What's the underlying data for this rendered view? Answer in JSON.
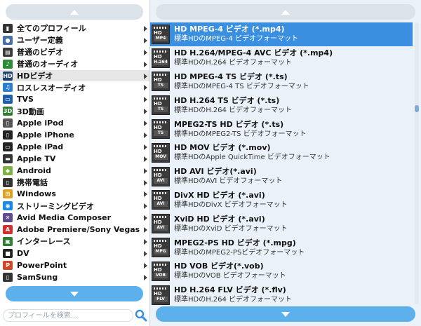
{
  "categories": [
    {
      "label": "全てのプロフィール",
      "icon": "all-profiles-icon",
      "color": "#333333",
      "glyph": "▮"
    },
    {
      "label": "ユーザー定義",
      "icon": "user-icon",
      "color": "#4a6fa5",
      "glyph": "●"
    },
    {
      "label": "普通のビデオ",
      "icon": "video-icon",
      "color": "#3a3a3a",
      "glyph": "▤"
    },
    {
      "label": "普通のオーディオ",
      "icon": "music-icon",
      "color": "#2e8b3a",
      "glyph": "♪"
    },
    {
      "label": "HDビデオ",
      "icon": "hd-video-icon",
      "color": "#1f3f6f",
      "glyph": "HD",
      "selected": true
    },
    {
      "label": "ロスレスオーディオ",
      "icon": "lossless-audio-icon",
      "color": "#2a7fd0",
      "glyph": "♫"
    },
    {
      "label": "TVS",
      "icon": "tv-icon",
      "color": "#1e5fa8",
      "glyph": "▭"
    },
    {
      "label": "3D動画",
      "icon": "3d-video-icon",
      "color": "#2e7d32",
      "glyph": "3D"
    },
    {
      "label": "Apple iPod",
      "icon": "ipod-icon",
      "color": "#555555",
      "glyph": "▯"
    },
    {
      "label": "Apple iPhone",
      "icon": "iphone-icon",
      "color": "#222222",
      "glyph": "▯"
    },
    {
      "label": "Apple iPad",
      "icon": "ipad-icon",
      "color": "#222222",
      "glyph": "▭"
    },
    {
      "label": "Apple TV",
      "icon": "apple-tv-icon",
      "color": "#333333",
      "glyph": "▬"
    },
    {
      "label": "Android",
      "icon": "android-icon",
      "color": "#7cb342",
      "glyph": "◆"
    },
    {
      "label": "携帯電話",
      "icon": "mobile-phone-icon",
      "color": "#333333",
      "glyph": "▯"
    },
    {
      "label": "Windows",
      "icon": "windows-icon",
      "color": "#e0a020",
      "glyph": "⊞"
    },
    {
      "label": "ストリーミングビデオ",
      "icon": "streaming-icon",
      "color": "#1e88e5",
      "glyph": "◉"
    },
    {
      "label": "Avid Media Composer",
      "icon": "avid-icon",
      "color": "#5e4b8b",
      "glyph": "✕"
    },
    {
      "label": "Adobe Premiere/Sony Vegas",
      "icon": "adobe-icon",
      "color": "#d32f2f",
      "glyph": "A"
    },
    {
      "label": "インターレース",
      "icon": "interlace-icon",
      "color": "#2e7d32",
      "glyph": "▣"
    },
    {
      "label": "DV",
      "icon": "dv-camera-icon",
      "color": "#222222",
      "glyph": "■"
    },
    {
      "label": "PowerPoint",
      "icon": "powerpoint-icon",
      "color": "#d24726",
      "glyph": "P"
    },
    {
      "label": "SamSung",
      "icon": "samsung-icon",
      "color": "#333333",
      "glyph": "▯"
    }
  ],
  "formats": [
    {
      "title": "HD MPEG-4 ビデオ (*.mp4)",
      "desc": "標準HDのMPEG-4 ビデオフォーマット",
      "tag": "MP4",
      "selected": true
    },
    {
      "title": "HD H.264/MPEG-4 AVC ビデオ (*.mp4)",
      "desc": "標準HDのH.264 ビデオフォーマット",
      "tag": "H.264"
    },
    {
      "title": "HD MPEG-4 TS ビデオ (*.ts)",
      "desc": "標準HDのMPEG-4 TS ビデオフォーマット",
      "tag": "TS"
    },
    {
      "title": "HD H.264 TS ビデオ (*.ts)",
      "desc": "標準HDのH.264 ビデオフォーマット",
      "tag": "TS"
    },
    {
      "title": "MPEG2-TS HD ビデオ (*.ts)",
      "desc": "標準HDのMPEG2-TS ビデオフォーマット",
      "tag": "TS"
    },
    {
      "title": "HD MOV ビデオ (*.mov)",
      "desc": "標準HDのApple QuickTime ビデオフォーマット",
      "tag": "MOV"
    },
    {
      "title": "HD AVI ビデオ(*.avi)",
      "desc": "標準HDのAVI ビデオフォーマット",
      "tag": "AVI"
    },
    {
      "title": "DivX HD ビデオ (*.avi)",
      "desc": "標準HDのDivX ビデオフォーマット",
      "tag": "AVI"
    },
    {
      "title": "XviD HD ビデオ (*.avi)",
      "desc": "標準HDのXviD ビデオフォーマット",
      "tag": "AVI"
    },
    {
      "title": "MPEG2-PS HD ビデオ (*.mpg)",
      "desc": "標準HDのMPEG2-PSビデオフォーマット",
      "tag": "MPG"
    },
    {
      "title": "HD VOB ビデオ(*.vob)",
      "desc": "標準HDのVOB ビデオフォーマット",
      "tag": "VOB"
    },
    {
      "title": "HD H.264 FLV ビデオ (*.flv)",
      "desc": "標準HDのH.264 ビデオフォーマット",
      "tag": "FLV"
    }
  ],
  "search": {
    "placeholder": "プロフィールを検索..."
  },
  "scrollbar": {
    "position_fraction": 0.3
  },
  "colors": {
    "accent": "#3a8fe0",
    "button": "#5cb0ec"
  }
}
